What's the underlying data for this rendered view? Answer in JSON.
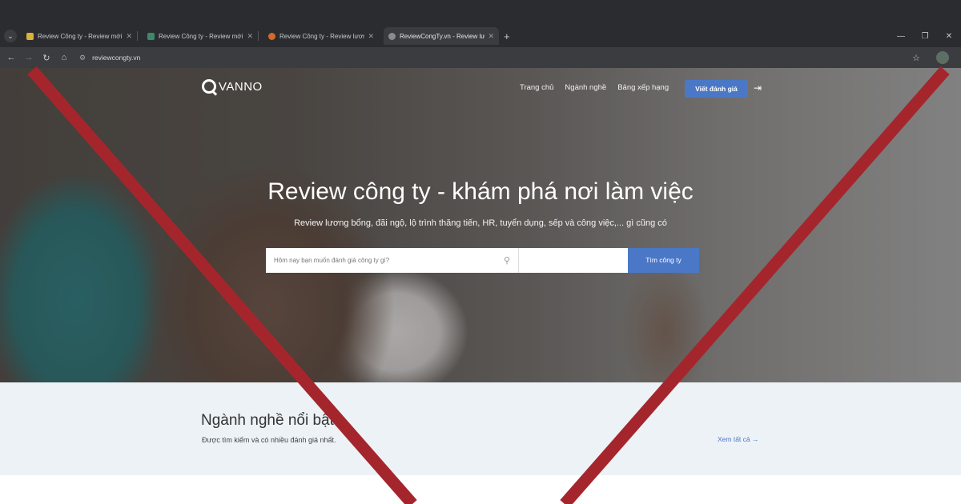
{
  "browser": {
    "tabs": [
      {
        "title": "Review Công ty - Review mới...",
        "favicon_color": "#d9b23a"
      },
      {
        "title": "Review Công ty - Review mới...",
        "favicon_color": "#3a8a6a"
      },
      {
        "title": "Review Công ty - Review lương",
        "favicon_color": "#d26a2a"
      },
      {
        "title": "ReviewCongTy.vn - Review lươn",
        "favicon_color": "#8a8b8f"
      }
    ],
    "active_tab_index": 3,
    "url": "reviewcongty.vn"
  },
  "nav": {
    "logo_text": "VANNO",
    "menu": [
      "Trang chủ",
      "Ngành nghề",
      "Bảng xếp hạng"
    ],
    "cta": "Viết đánh giá"
  },
  "hero": {
    "title": "Review công ty - khám phá nơi làm việc",
    "subtitle": "Review lương bổng, đãi ngộ, lộ trình thăng tiến, HR, tuyển dụng, sếp và công việc,... gì cũng có",
    "search_placeholder": "Hôm nay bạn muốn đánh giá công ty gì?",
    "search_button": "Tìm công ty"
  },
  "section": {
    "title": "Ngành nghề nổi bật",
    "subtitle": "Được tìm kiếm và có nhiều đánh giá nhất.",
    "link": "Xem tất cả"
  },
  "colors": {
    "accent": "#4a78c6",
    "overlay_red": "#a4262c"
  }
}
